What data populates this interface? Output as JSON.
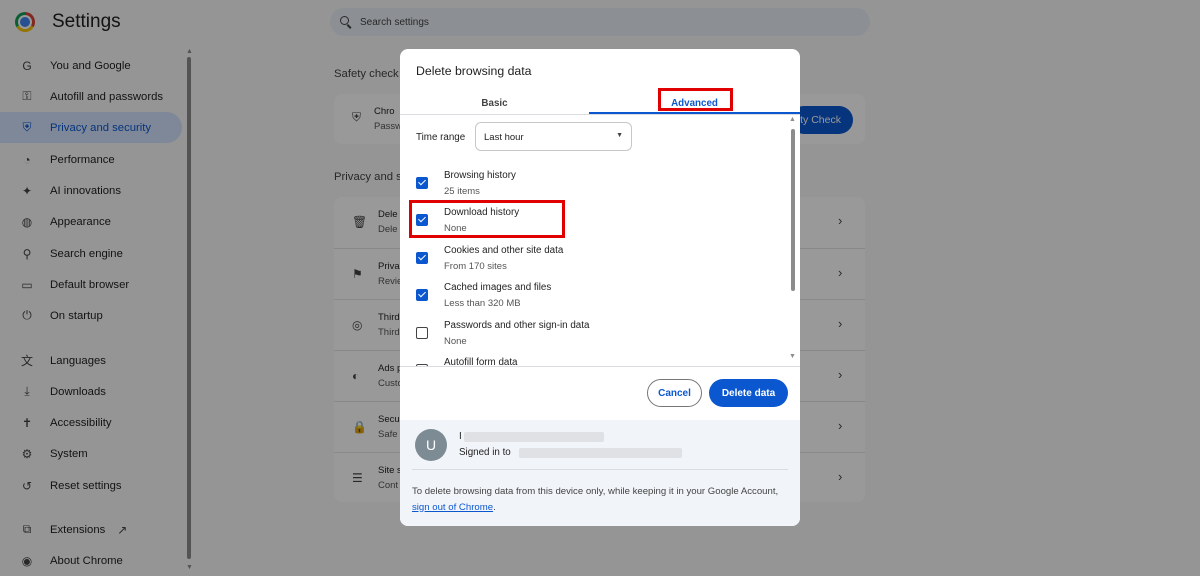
{
  "header": {
    "app_title": "Settings",
    "search_placeholder": "Search settings"
  },
  "sidebar": {
    "items": [
      {
        "label": "You and Google",
        "icon": "google-icon"
      },
      {
        "label": "Autofill and passwords",
        "icon": "key-icon"
      },
      {
        "label": "Privacy and security",
        "icon": "shield-icon",
        "active": true
      },
      {
        "label": "Performance",
        "icon": "gauge-icon"
      },
      {
        "label": "AI innovations",
        "icon": "sparkle-icon"
      },
      {
        "label": "Appearance",
        "icon": "palette-icon"
      },
      {
        "label": "Search engine",
        "icon": "search-icon"
      },
      {
        "label": "Default browser",
        "icon": "browser-icon"
      },
      {
        "label": "On startup",
        "icon": "power-icon"
      },
      {
        "label": "Languages",
        "icon": "translate-icon"
      },
      {
        "label": "Downloads",
        "icon": "download-icon"
      },
      {
        "label": "Accessibility",
        "icon": "accessibility-icon"
      },
      {
        "label": "System",
        "icon": "wrench-icon"
      },
      {
        "label": "Reset settings",
        "icon": "reset-icon"
      },
      {
        "label": "Extensions",
        "icon": "puzzle-icon"
      },
      {
        "label": "About Chrome",
        "icon": "chrome-icon"
      }
    ]
  },
  "main": {
    "safety_check_label": "Safety check",
    "safety_card": {
      "title": "Chro",
      "subtitle": "Passw",
      "button": "ty Check"
    },
    "privacy_label": "Privacy and s",
    "privacy_rows": [
      {
        "t1": "Dele",
        "t2": "Dele",
        "icon": "trash-icon"
      },
      {
        "t1": "Priva",
        "t2": "Revie",
        "icon": "privacy-guide-icon"
      },
      {
        "t1": "Third",
        "t2": "Third",
        "icon": "cookie-icon"
      },
      {
        "t1": "Ads p",
        "t2": "Custo",
        "icon": "ads-icon"
      },
      {
        "t1": "Secu",
        "t2": "Safe",
        "icon": "lock-icon"
      },
      {
        "t1": "Site s",
        "t2": "Cont",
        "icon": "tune-icon"
      }
    ]
  },
  "dialog": {
    "title": "Delete browsing data",
    "tabs": [
      {
        "label": "Basic"
      },
      {
        "label": "Advanced",
        "selected": true
      }
    ],
    "time_range": {
      "label": "Time range",
      "value": "Last hour"
    },
    "options": [
      {
        "title": "Browsing history",
        "detail": "25 items",
        "checked": true
      },
      {
        "title": "Download history",
        "detail": "None",
        "checked": true
      },
      {
        "title": "Cookies and other site data",
        "detail": "From 170 sites",
        "checked": true
      },
      {
        "title": "Cached images and files",
        "detail": "Less than 320 MB",
        "checked": true
      },
      {
        "title": "Passwords and other sign-in data",
        "detail": "None",
        "checked": false
      },
      {
        "title": "Autofill form data",
        "detail": "",
        "checked": false
      }
    ],
    "cancel_label": "Cancel",
    "delete_label": "Delete data",
    "account": {
      "avatar_letter": "U",
      "name": "I",
      "signed_in_text": "Signed in to"
    },
    "footer_note": "To delete browsing data from this device only, while keeping it in your Google Account, ",
    "footer_link": "sign out of Chrome",
    "footer_end": "."
  },
  "colors": {
    "accent": "#0b57d0",
    "highlight_box": "#e00000",
    "sidebar_active_bg": "#d3e3fd"
  }
}
